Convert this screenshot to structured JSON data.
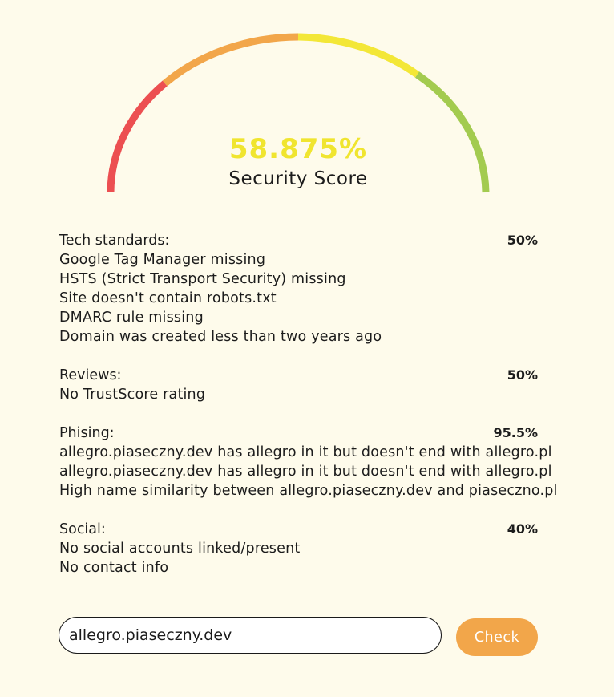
{
  "gauge": {
    "score_text": "58.875%",
    "score_fraction": 0.58875,
    "label": "Security Score",
    "score_color": "#f0e52f",
    "segments": [
      {
        "name": "red",
        "color": "#ec4f51"
      },
      {
        "name": "orange",
        "color": "#f2a64a"
      },
      {
        "name": "yellow",
        "color": "#f3e737"
      },
      {
        "name": "green",
        "color": "#a3cb4f"
      }
    ]
  },
  "sections": [
    {
      "title": "Tech standards:",
      "score": "50%",
      "issues": [
        "Google Tag Manager missing",
        "HSTS (Strict Transport Security) missing",
        "Site doesn't contain robots.txt",
        "DMARC rule missing",
        "Domain was created less than two years ago"
      ]
    },
    {
      "title": "Reviews:",
      "score": "50%",
      "issues": [
        "No TrustScore rating"
      ]
    },
    {
      "title": "Phising:",
      "score": "95.5%",
      "issues": [
        "allegro.piaseczny.dev has allegro in it but doesn't end with allegro.pl",
        "allegro.piaseczny.dev has allegro in it but doesn't end with allegro.pl",
        "High name similarity between allegro.piaseczny.dev and piaseczno.pl"
      ]
    },
    {
      "title": "Social:",
      "score": "40%",
      "issues": [
        "No social accounts linked/present",
        "No contact info"
      ]
    }
  ],
  "search": {
    "value": "allegro.piaseczny.dev",
    "button_label": "Check"
  },
  "colors": {
    "background": "#fefbeb",
    "accent": "#f2a64a"
  }
}
